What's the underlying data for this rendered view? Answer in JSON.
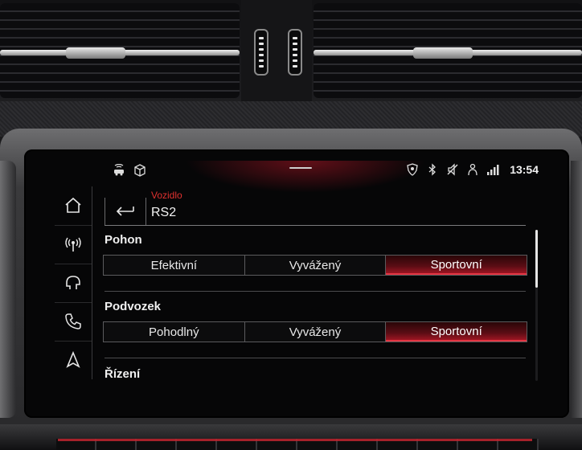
{
  "status_bar": {
    "time": "13:54",
    "left_icons": [
      "car-wifi-icon",
      "package-icon"
    ],
    "right_icons": [
      "location-shield-icon",
      "bluetooth-icon",
      "mute-icon",
      "phone-person-icon",
      "signal-bars-icon"
    ]
  },
  "nav": [
    {
      "icon": "home-icon"
    },
    {
      "icon": "radio-broadcast-icon"
    },
    {
      "icon": "media-icon"
    },
    {
      "icon": "phone-icon"
    },
    {
      "icon": "navigation-icon"
    }
  ],
  "header": {
    "breadcrumb": "Vozidlo",
    "title": "RS2"
  },
  "sections": {
    "pohon": {
      "title": "Pohon",
      "options": [
        "Efektivní",
        "Vyvážený",
        "Sportovní"
      ],
      "selected": "Sportovní"
    },
    "podvozek": {
      "title": "Podvozek",
      "options": [
        "Pohodlný",
        "Vyvážený",
        "Sportovní"
      ],
      "selected": "Sportovní"
    },
    "rizeni": {
      "title": "Řízení"
    }
  },
  "colors": {
    "accent_red": "#e0312f",
    "selected_fill": "#9c1522",
    "screen_bg": "#060607",
    "text": "#f0f0f0"
  }
}
